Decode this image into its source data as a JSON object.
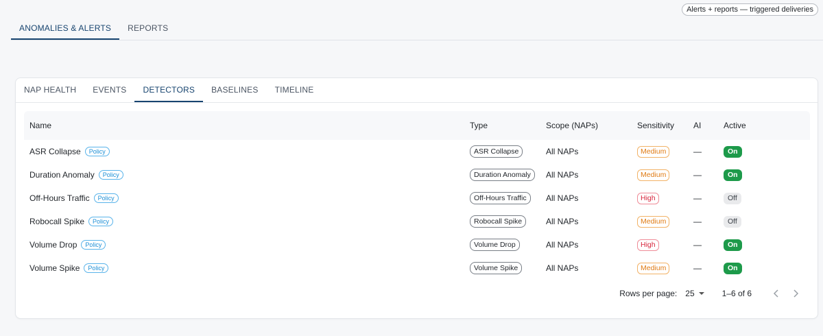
{
  "header": {
    "deliveries_chip": "Alerts + reports — triggered deliveries",
    "tabs": [
      {
        "label": "ANOMALIES & ALERTS",
        "active": true
      },
      {
        "label": "REPORTS",
        "active": false
      }
    ]
  },
  "card": {
    "tabs": [
      {
        "label": "NAP HEALTH",
        "active": false
      },
      {
        "label": "EVENTS",
        "active": false
      },
      {
        "label": "DETECTORS",
        "active": true
      },
      {
        "label": "BASELINES",
        "active": false
      },
      {
        "label": "TIMELINE",
        "active": false
      }
    ],
    "table": {
      "columns": [
        "Name",
        "Type",
        "Scope (NAPs)",
        "Sensitivity",
        "AI",
        "Active"
      ],
      "rows": [
        {
          "name": "ASR Collapse",
          "badge": "Policy",
          "type": "ASR Collapse",
          "scope": "All NAPs",
          "sensitivity": "Medium",
          "ai": "—",
          "active": "On"
        },
        {
          "name": "Duration Anomaly",
          "badge": "Policy",
          "type": "Duration Anomaly",
          "scope": "All NAPs",
          "sensitivity": "Medium",
          "ai": "—",
          "active": "On"
        },
        {
          "name": "Off-Hours Traffic",
          "badge": "Policy",
          "type": "Off-Hours Traffic",
          "scope": "All NAPs",
          "sensitivity": "High",
          "ai": "—",
          "active": "Off"
        },
        {
          "name": "Robocall Spike",
          "badge": "Policy",
          "type": "Robocall Spike",
          "scope": "All NAPs",
          "sensitivity": "Medium",
          "ai": "—",
          "active": "Off"
        },
        {
          "name": "Volume Drop",
          "badge": "Policy",
          "type": "Volume Drop",
          "scope": "All NAPs",
          "sensitivity": "High",
          "ai": "—",
          "active": "On"
        },
        {
          "name": "Volume Spike",
          "badge": "Policy",
          "type": "Volume Spike",
          "scope": "All NAPs",
          "sensitivity": "Medium",
          "ai": "—",
          "active": "On"
        }
      ]
    },
    "pagination": {
      "rows_per_page_label": "Rows per page:",
      "rows_per_page": "25",
      "range": "1–6 of 6",
      "prev_icon": "chevron-left-icon",
      "next_icon": "chevron-right-icon"
    }
  },
  "colors": {
    "accent": "#17446f",
    "policy": "#1d8fd6",
    "medium": "#e07b14",
    "high": "#d7263d",
    "on": "#1d9a4a",
    "off": "#e9eaec"
  }
}
